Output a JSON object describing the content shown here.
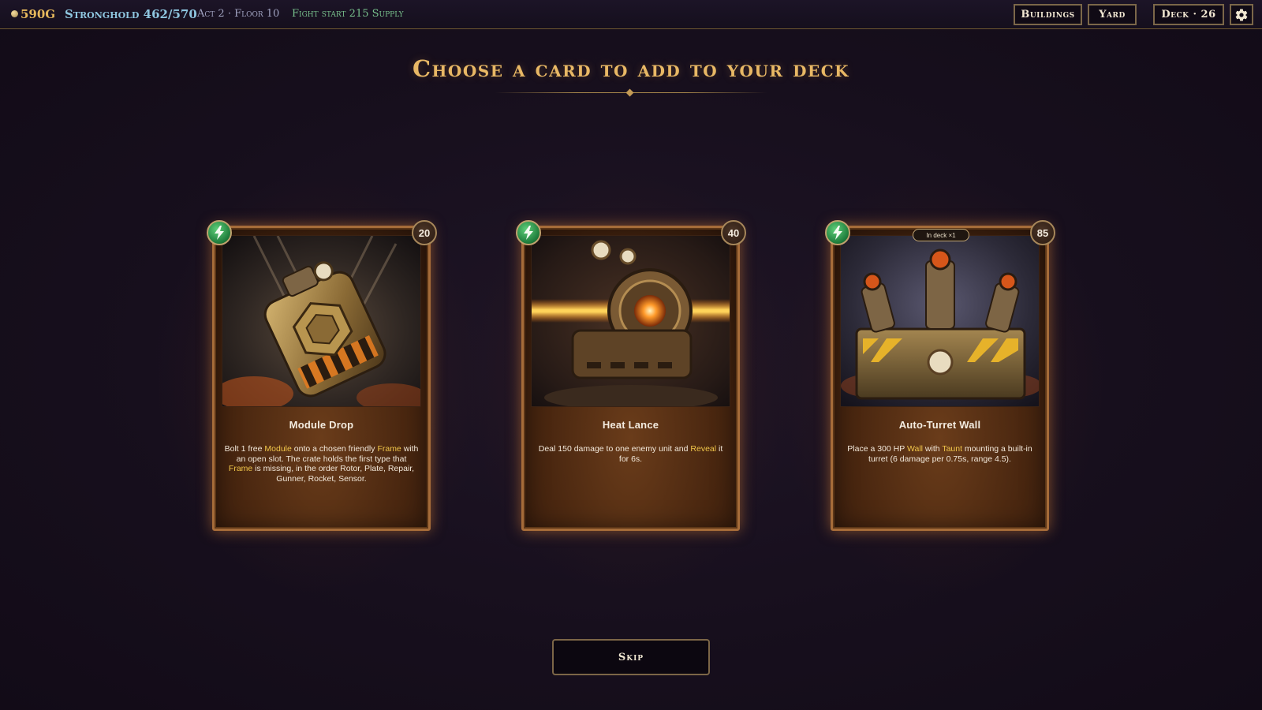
{
  "hud": {
    "gold": "590G",
    "stronghold": "Stronghold 462/570",
    "act_floor": "Act 2 · Floor 10",
    "supply": "Fight start 215 Supply"
  },
  "nav": {
    "buildings": "Buildings",
    "yard": "Yard",
    "deck": "Deck · 26",
    "settings_icon": "gear-icon"
  },
  "heading": "Choose a card to add to your deck",
  "cards": [
    {
      "name": "Module Drop",
      "cost": "20",
      "energy_icon": "lightning-icon",
      "description": [
        {
          "t": "Bolt 1 free ",
          "k": false
        },
        {
          "t": "Module",
          "k": true
        },
        {
          "t": " onto a chosen friendly ",
          "k": false
        },
        {
          "t": "Frame",
          "k": true
        },
        {
          "t": " with an open slot. The crate holds the first type that ",
          "k": false
        },
        {
          "t": "Frame",
          "k": true
        },
        {
          "t": " is missing, in the order Rotor, Plate, Repair, Gunner, Rocket, Sensor.",
          "k": false
        }
      ]
    },
    {
      "name": "Heat Lance",
      "cost": "40",
      "energy_icon": "lightning-icon",
      "description": [
        {
          "t": "Deal 150 damage to one enemy unit and ",
          "k": false
        },
        {
          "t": "Reveal",
          "k": true
        },
        {
          "t": " it for 6s.",
          "k": false
        }
      ]
    },
    {
      "name": "Auto-Turret Wall",
      "cost": "85",
      "energy_icon": "lightning-icon",
      "badge": "In deck ×1",
      "description": [
        {
          "t": "Place a 300 HP ",
          "k": false
        },
        {
          "t": "Wall",
          "k": true
        },
        {
          "t": " with ",
          "k": false
        },
        {
          "t": "Taunt",
          "k": true
        },
        {
          "t": " mounting a built-in turret (6 damage per 0.75s, range 4.5).",
          "k": false
        }
      ]
    }
  ],
  "skip": "Skip",
  "colors": {
    "accent_gold": "#e8b865",
    "keyword": "#f0c64a",
    "card_border": "#a66c39",
    "energy_green": "#1d7a3a"
  }
}
